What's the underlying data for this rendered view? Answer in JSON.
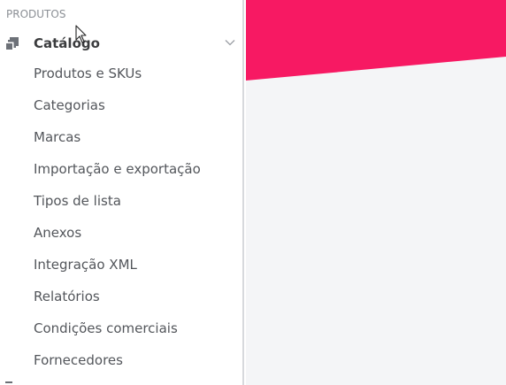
{
  "sidebar": {
    "section_title": "PRODUTOS",
    "category": {
      "label": "Catálogo",
      "icon": "catalog-icon",
      "expanded": true
    },
    "items": [
      {
        "label": "Produtos e SKUs"
      },
      {
        "label": "Categorias"
      },
      {
        "label": "Marcas"
      },
      {
        "label": "Importação e exportação"
      },
      {
        "label": "Tipos de lista"
      },
      {
        "label": "Anexos"
      },
      {
        "label": "Integração XML"
      },
      {
        "label": "Relatórios"
      },
      {
        "label": "Condições comerciais"
      },
      {
        "label": "Fornecedores"
      }
    ]
  },
  "colors": {
    "banner": "#f71963",
    "content_bg": "#f4f5f7",
    "sidebar_border": "#d7d9dd"
  }
}
